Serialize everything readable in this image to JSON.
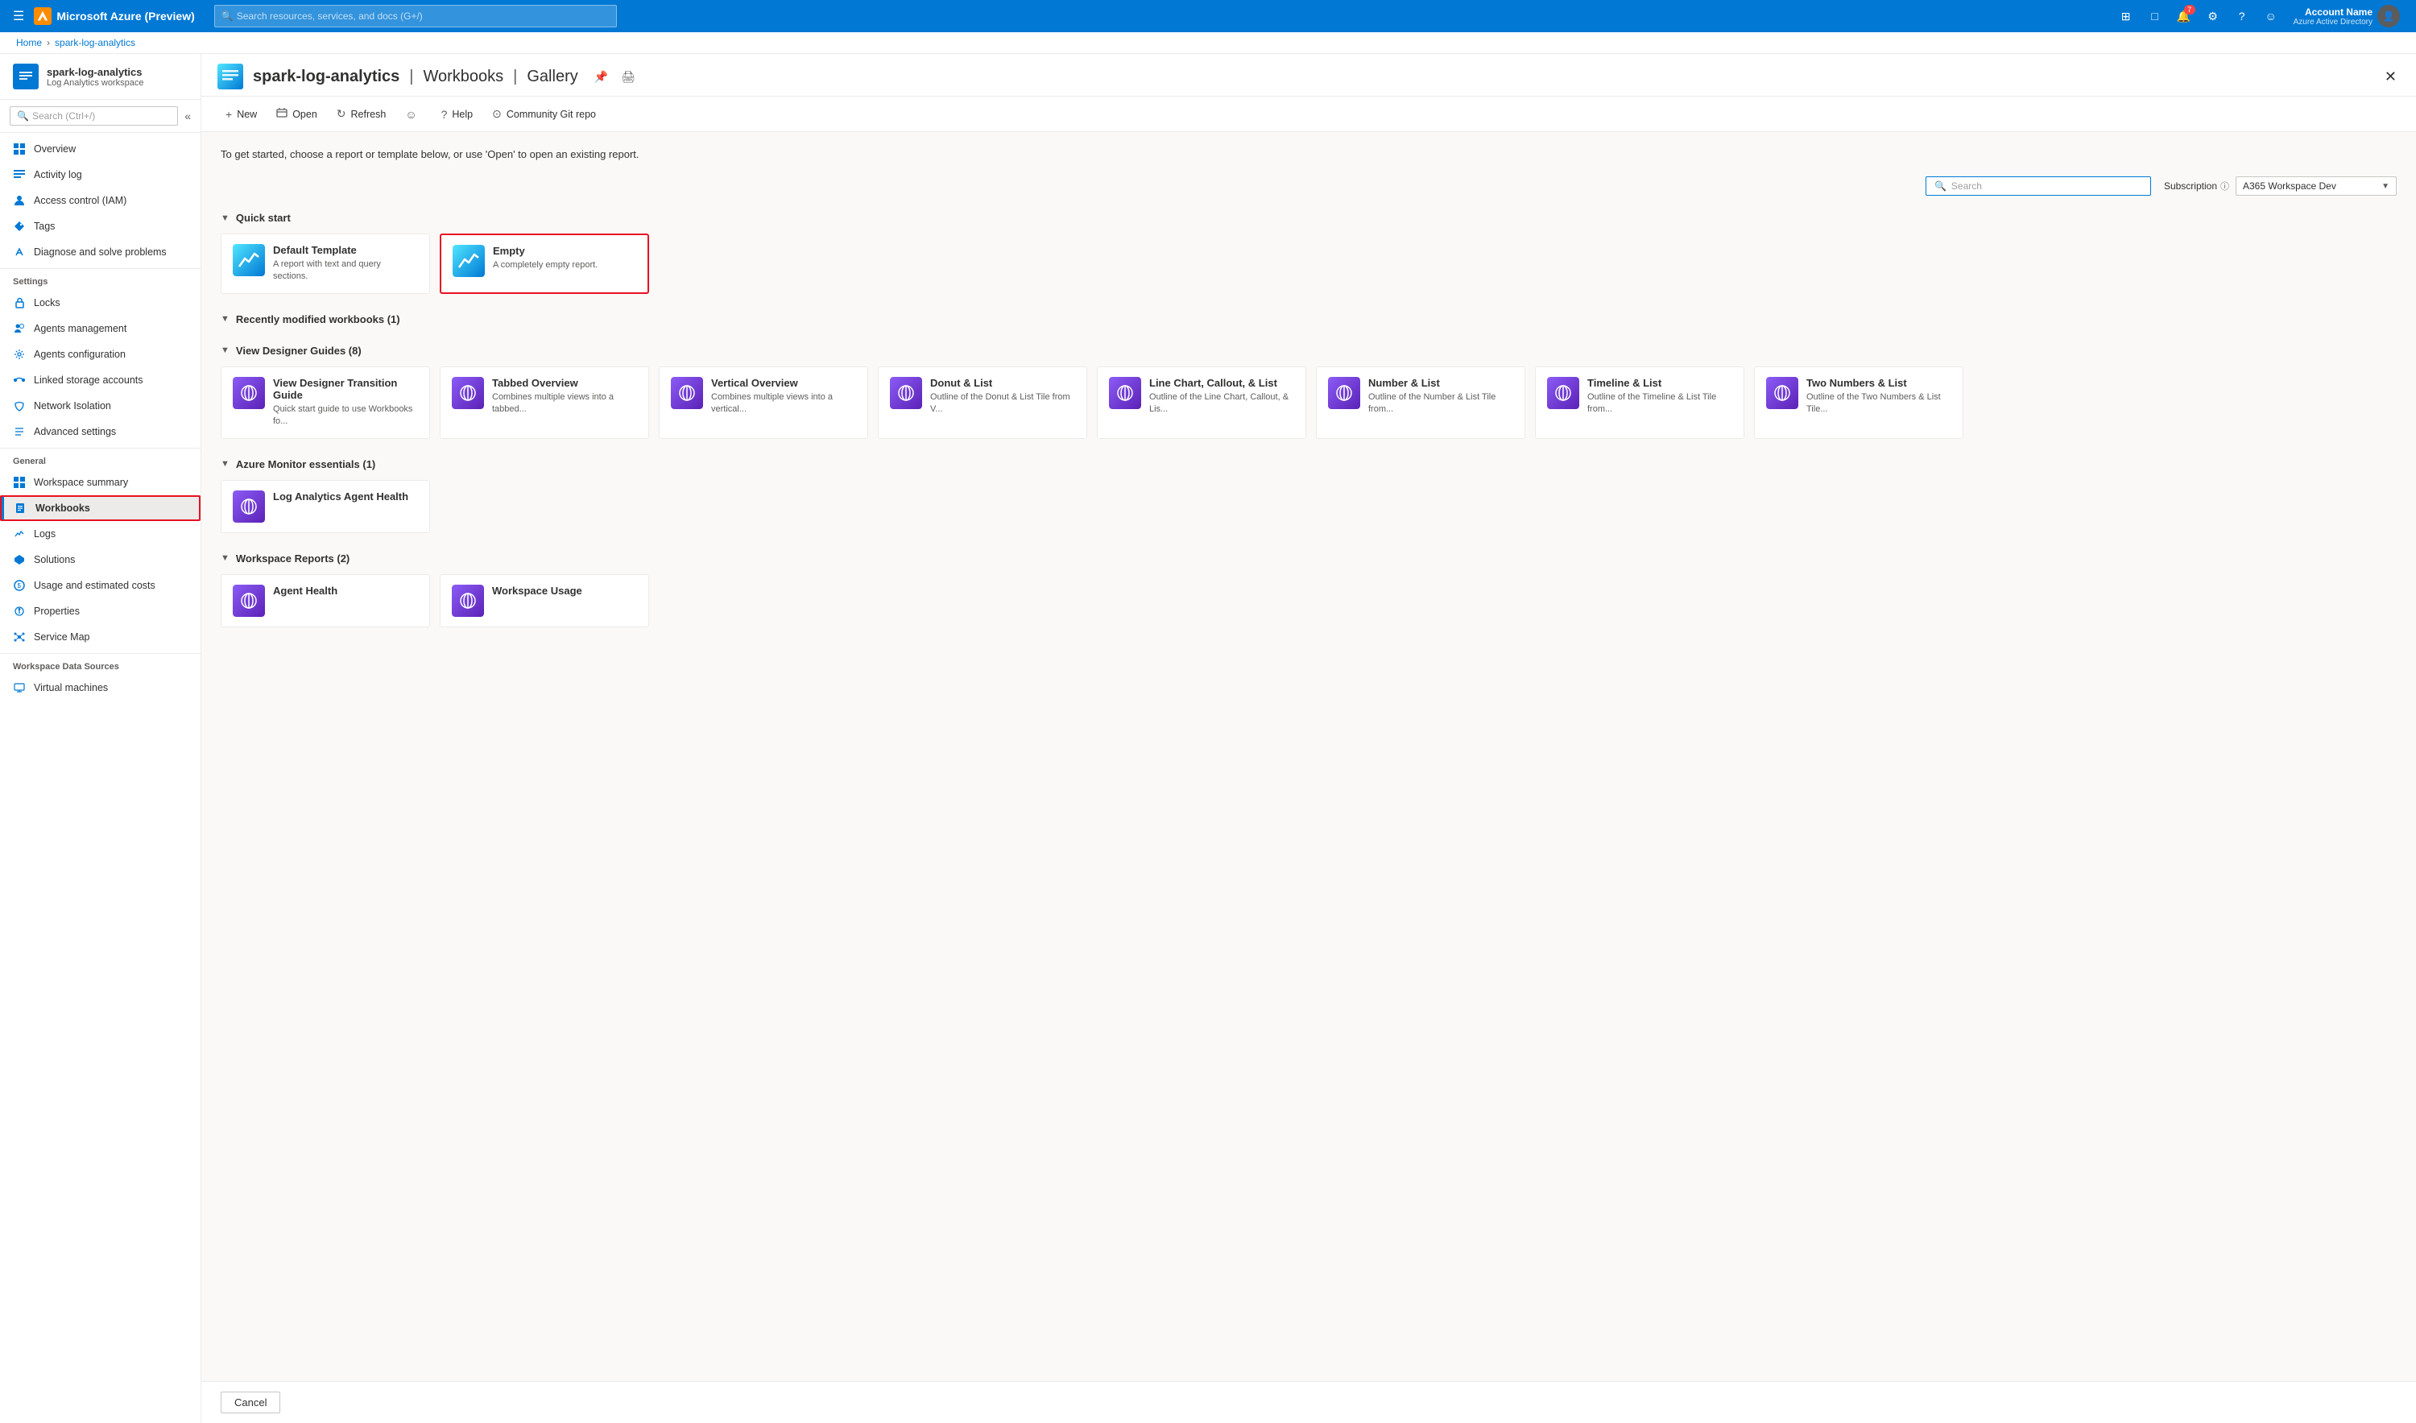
{
  "topbar": {
    "logo_text": "Microsoft Azure (Preview)",
    "search_placeholder": "Search resources, services, and docs (G+/)",
    "notification_count": "7",
    "account_name": "Account Name",
    "account_sub": "Azure Active Directory"
  },
  "breadcrumb": {
    "home": "Home",
    "resource": "spark-log-analytics"
  },
  "sidebar": {
    "title": "spark-log-analytics",
    "subtitle": "Log Analytics workspace",
    "search_placeholder": "Search (Ctrl+/)",
    "sections": {
      "settings_label": "Settings",
      "general_label": "General",
      "workspace_data_sources_label": "Workspace Data Sources"
    },
    "nav_items": [
      {
        "id": "overview",
        "label": "Overview",
        "icon": "grid"
      },
      {
        "id": "activity-log",
        "label": "Activity log",
        "icon": "list"
      },
      {
        "id": "access-control",
        "label": "Access control (IAM)",
        "icon": "person"
      },
      {
        "id": "tags",
        "label": "Tags",
        "icon": "tag"
      },
      {
        "id": "diagnose",
        "label": "Diagnose and solve problems",
        "icon": "wrench"
      },
      {
        "id": "locks",
        "label": "Locks",
        "icon": "lock"
      },
      {
        "id": "agents-management",
        "label": "Agents management",
        "icon": "person-settings"
      },
      {
        "id": "agents-configuration",
        "label": "Agents configuration",
        "icon": "settings"
      },
      {
        "id": "linked-storage",
        "label": "Linked storage accounts",
        "icon": "link"
      },
      {
        "id": "network-isolation",
        "label": "Network Isolation",
        "icon": "network"
      },
      {
        "id": "advanced-settings",
        "label": "Advanced settings",
        "icon": "settings-adv"
      },
      {
        "id": "workspace-summary",
        "label": "Workspace summary",
        "icon": "grid-small"
      },
      {
        "id": "workbooks",
        "label": "Workbooks",
        "icon": "book",
        "active": true
      },
      {
        "id": "logs",
        "label": "Logs",
        "icon": "logs"
      },
      {
        "id": "solutions",
        "label": "Solutions",
        "icon": "solutions"
      },
      {
        "id": "usage-costs",
        "label": "Usage and estimated costs",
        "icon": "circle-dollar"
      },
      {
        "id": "properties",
        "label": "Properties",
        "icon": "info"
      },
      {
        "id": "service-map",
        "label": "Service Map",
        "icon": "service-map"
      },
      {
        "id": "virtual-machines",
        "label": "Virtual machines",
        "icon": "vm"
      }
    ]
  },
  "page": {
    "title": "spark-log-analytics",
    "separator": "|",
    "subtitle": "Workbooks",
    "section": "Gallery",
    "description": "To get started, choose a report or template below, or use 'Open' to open an existing report."
  },
  "toolbar": {
    "new_label": "New",
    "open_label": "Open",
    "refresh_label": "Refresh",
    "feedback_label": "",
    "help_label": "Help",
    "community_label": "Community Git repo"
  },
  "gallery_filter": {
    "search_placeholder": "Search",
    "subscription_label": "Subscription",
    "subscription_value": "A365 Workspace Dev"
  },
  "quick_start": {
    "section_label": "Quick start",
    "cards": [
      {
        "id": "default-template",
        "title": "Default Template",
        "desc": "A report with text and query sections."
      },
      {
        "id": "empty",
        "title": "Empty",
        "desc": "A completely empty report.",
        "selected": true
      }
    ]
  },
  "recently_modified": {
    "section_label": "Recently modified workbooks (1)"
  },
  "view_designer": {
    "section_label": "View Designer Guides (8)",
    "cards": [
      {
        "id": "vd-transition",
        "title": "View Designer Transition Guide",
        "desc": "Quick start guide to use Workbooks fo..."
      },
      {
        "id": "tabbed-overview",
        "title": "Tabbed Overview",
        "desc": "Combines multiple views into a tabbed..."
      },
      {
        "id": "vertical-overview",
        "title": "Vertical Overview",
        "desc": "Combines multiple views into a vertical..."
      },
      {
        "id": "donut-list",
        "title": "Donut & List",
        "desc": "Outline of the Donut & List Tile from V..."
      },
      {
        "id": "line-chart",
        "title": "Line Chart, Callout, & List",
        "desc": "Outline of the Line Chart, Callout, & Lis..."
      },
      {
        "id": "number-list",
        "title": "Number & List",
        "desc": "Outline of the Number & List Tile from..."
      },
      {
        "id": "timeline-list",
        "title": "Timeline & List",
        "desc": "Outline of the Timeline & List Tile from..."
      },
      {
        "id": "two-numbers-list",
        "title": "Two Numbers & List",
        "desc": "Outline of the Two Numbers & List Tile..."
      }
    ]
  },
  "azure_monitor": {
    "section_label": "Azure Monitor essentials (1)",
    "cards": [
      {
        "id": "log-analytics-agent-health",
        "title": "Log Analytics Agent Health",
        "desc": ""
      }
    ]
  },
  "workspace_reports": {
    "section_label": "Workspace Reports (2)",
    "cards": [
      {
        "id": "agent-health",
        "title": "Agent Health",
        "desc": ""
      },
      {
        "id": "workspace-usage",
        "title": "Workspace Usage",
        "desc": ""
      }
    ]
  },
  "footer": {
    "cancel_label": "Cancel"
  },
  "icons": {
    "hamburger": "☰",
    "search": "🔍",
    "bell": "🔔",
    "portal": "⊞",
    "cloud": "☁",
    "gear": "⚙",
    "question": "?",
    "smiley": "☺",
    "close": "✕",
    "chevron_down": "▼",
    "chevron_right": "›",
    "collapse": "«",
    "plus": "+",
    "refresh_icon": "↻",
    "open_icon": "📂",
    "help_icon": "?",
    "community_icon": "⊙",
    "info_icon": "ⓘ",
    "pin": "📌",
    "print": "🖨"
  }
}
